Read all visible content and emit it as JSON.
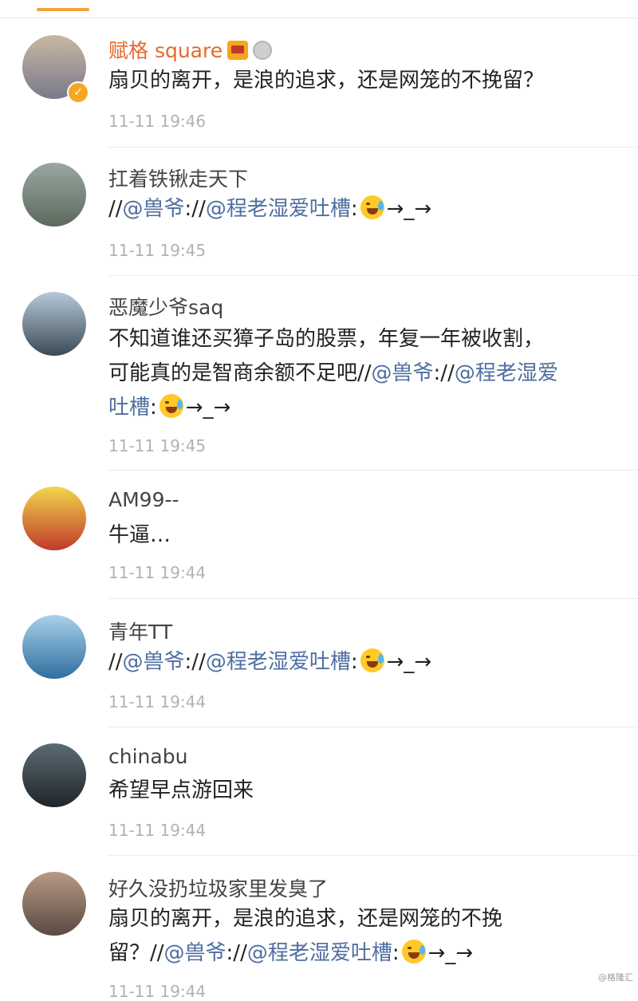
{
  "comments": [
    {
      "username": "赋格 square",
      "segments": [
        {
          "text": "扇贝的离开，是浪的追求，还是网笼的不挽留？",
          "mention": false
        }
      ],
      "time": "11-11 19:46",
      "avatar_colors": [
        "#c9b7a3",
        "#7a7a8c"
      ]
    },
    {
      "username": "扛着铁锹走天下",
      "segments": [
        {
          "text": "//",
          "mention": false
        },
        {
          "text": "@兽爷",
          "mention": true
        },
        {
          "text": "://",
          "mention": false
        },
        {
          "text": "@程老湿爱吐槽",
          "mention": true
        },
        {
          "text": ":",
          "mention": false
        }
      ],
      "trail": "→_→",
      "time": "11-11 19:45",
      "avatar_colors": [
        "#9aa6a3",
        "#5b6a5c"
      ]
    },
    {
      "username": "恶魔少爷saq",
      "segments": [
        {
          "text": "不知道谁还买獐子岛的股票，年复一年被收割，",
          "mention": false
        },
        {
          "text": "可能真的是智商余额不足吧//",
          "mention": false
        },
        {
          "text": "@兽爷",
          "mention": true
        },
        {
          "text": "://",
          "mention": false
        },
        {
          "text": "@程老湿爱",
          "mention": true
        },
        {
          "text": "吐槽",
          "mention": true
        },
        {
          "text": ":",
          "mention": false
        }
      ],
      "trail": "→_→",
      "time": "11-11 19:45",
      "avatar_colors": [
        "#b7c8d8",
        "#3a4a55"
      ]
    },
    {
      "username": "AM99--",
      "segments": [
        {
          "text": "牛逼…",
          "mention": false
        }
      ],
      "time": "11-11 19:44",
      "avatar_colors": [
        "#f2d64b",
        "#c0392b"
      ]
    },
    {
      "username": "青年TT",
      "segments": [
        {
          "text": "//",
          "mention": false
        },
        {
          "text": "@兽爷",
          "mention": true
        },
        {
          "text": "://",
          "mention": false
        },
        {
          "text": "@程老湿爱吐槽",
          "mention": true
        },
        {
          "text": ":",
          "mention": false
        }
      ],
      "trail": "→_→",
      "time": "11-11 19:44",
      "avatar_colors": [
        "#a9d0ea",
        "#2f6f9f"
      ]
    },
    {
      "username": "chinabu",
      "segments": [
        {
          "text": "希望早点游回来",
          "mention": false
        }
      ],
      "time": "11-11 19:44",
      "avatar_colors": [
        "#5c6b74",
        "#1f2529"
      ]
    },
    {
      "username": "好久没扔垃圾家里发臭了",
      "segments": [
        {
          "text": "扇贝的离开，是浪的追求，还是网笼的不挽",
          "mention": false
        },
        {
          "text": "留？//",
          "mention": false
        },
        {
          "text": "@兽爷",
          "mention": true
        },
        {
          "text": "://",
          "mention": false
        },
        {
          "text": "@程老湿爱吐槽",
          "mention": true
        },
        {
          "text": ":",
          "mention": false
        }
      ],
      "trail": "→_→",
      "time": "11-11 19:44",
      "avatar_colors": [
        "#b89a86",
        "#5a4a44"
      ]
    }
  ],
  "watermark": "@格隆汇",
  "colors": {
    "accent": "#f4a237",
    "mention": "#4e6fa1",
    "vip_name": "#e8682e",
    "timestamp": "#b2b2b2"
  }
}
